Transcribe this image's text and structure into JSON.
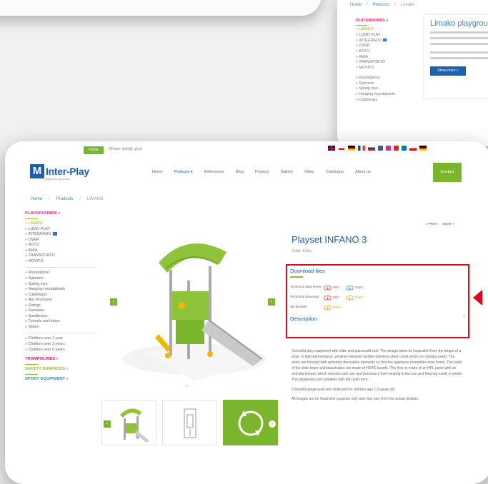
{
  "bg_shot": {
    "breadcrumb": [
      "Home",
      "/",
      "Products",
      "/",
      "Limako"
    ],
    "title": "Limako playgroun",
    "sidebar": {
      "header": "PLAYGROUNDS »",
      "items": [
        "» LIMAKO",
        "» LUMO PLAY",
        "» INTEGRADO",
        "» OVER",
        "» BOTO",
        "» AMIA",
        "» TRANSPORTO",
        "» MOVITO"
      ],
      "items2": [
        "» Roundabout",
        "» Spinners",
        "» Spring toys",
        "» Hanging roundabouts",
        "» Cableways"
      ]
    },
    "button": "Show more »"
  },
  "topbar": {
    "home_btn": "Home",
    "phone": "Phone: info@..pl.pl "
  },
  "logo": {
    "mark": "M",
    "text": "Inter-Play",
    "sub": "playground equipment"
  },
  "nav": {
    "items": [
      "Home",
      "Products ▾",
      "References",
      "Blog",
      "Projects",
      "Gallery",
      "Video",
      "Catalogue",
      "About us"
    ],
    "contact": "Contact"
  },
  "breadcrumb": [
    "Home",
    "/",
    "Products",
    "/",
    "LIMAKO"
  ],
  "sidebar": {
    "header": "PLAYGROUNDS »",
    "active": "» LIMAKO",
    "items": [
      "» LUMO PLAY",
      "» INTEGRADO",
      "» OVER",
      "» BOTO",
      "» AMIA",
      "» TRANSPORTO",
      "» MOVITO"
    ],
    "items2": [
      "» Roundabout",
      "» Spinners",
      "» Spring toys",
      "» Hanging roundabouts",
      "» Cableways",
      "» Net structures",
      "» Swings",
      "» Seesaws",
      "» Sandboxes",
      "» Tunnels and tubes",
      "» Slides"
    ],
    "items3": [
      "» Children over 1 year",
      "» Children over 3 years",
      "» Children over 6 years"
    ],
    "header2": "TRAMPOLINES »",
    "header3": "SAFETY SURFACES »",
    "header4": "SPORT EQUIPMENT »"
  },
  "gallery": {
    "dots": "● ○"
  },
  "product": {
    "prev": "« PREV",
    "next": "NEXT »",
    "title": "Playset INFANO 3",
    "code": "Code: K16a"
  },
  "downloads": {
    "heading": "Download files",
    "rows": [
      {
        "label": "Technical data sheet",
        "f1": "PDF",
        "f2": "DWG"
      },
      {
        "label": "Technical drawings",
        "f1": "PDF",
        "f2": "DWG"
      },
      {
        "label": "3D Models",
        "f1": "DWG"
      }
    ],
    "description_heading": "Description",
    "caret": "^"
  },
  "description": {
    "p1": "Colourful play equipment with slide and spacecraft roof. The design takes its inspiration from the shape of a snail. In high-performance, weather-resistant welded stainless steel construction (no clamps used). The posts are finished with spherical decorative elements so that the appliance resembles snail horns. The walls of the slide tower and balustrades are made of HDPE boards. The floor is made of an HPL panel with an anti-slip texture, which ensures safe use and prevents it from heating in the sun and freezing easily in winter. The playground set complies with EN (soft norm.",
    "p2": "Colourful playground sets dedicated to children age 1-3 years old.",
    "p3": "All images are for illustration purpose only and may vary from the actual product."
  },
  "colors": {
    "brand_blue": "#1e5fae",
    "green": "#7ab62c",
    "pink": "#ce2a80",
    "highlight_red": "#d50a1d"
  }
}
